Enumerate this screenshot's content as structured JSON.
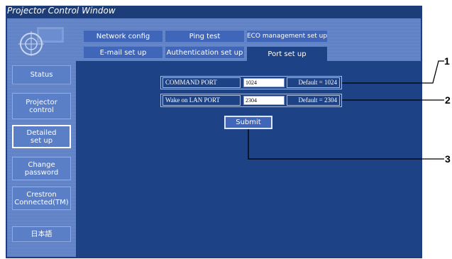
{
  "window": {
    "title": "Projector Control Window"
  },
  "sidebar": {
    "items": [
      {
        "label": "Status",
        "active": false
      },
      {
        "label": "Projector control",
        "active": false
      },
      {
        "label": "Detailed set up",
        "active": true
      },
      {
        "label": "Change password",
        "active": false
      },
      {
        "label": "Crestron Connected(TM)",
        "active": false
      },
      {
        "label": "日本語",
        "active": false
      }
    ]
  },
  "tabs": {
    "row1": [
      "Network config",
      "Ping test",
      "ECO management set up"
    ],
    "row2": [
      "E-mail set up",
      "Authentication set up",
      "Port set up"
    ],
    "active": "Port set up"
  },
  "form": {
    "rows": [
      {
        "label": "COMMAND PORT",
        "value": "1024",
        "default": "Default = 1024"
      },
      {
        "label": "Wake on LAN PORT",
        "value": "2304",
        "default": "Default = 2304"
      }
    ],
    "submit_label": "Submit"
  },
  "callouts": [
    "1",
    "2",
    "3"
  ],
  "colors": {
    "titlebar": "#1d3d79",
    "content_bg": "#1e4286",
    "tab_bg": "#3f66b8",
    "sidebar_btn": "#5a7fc7"
  }
}
